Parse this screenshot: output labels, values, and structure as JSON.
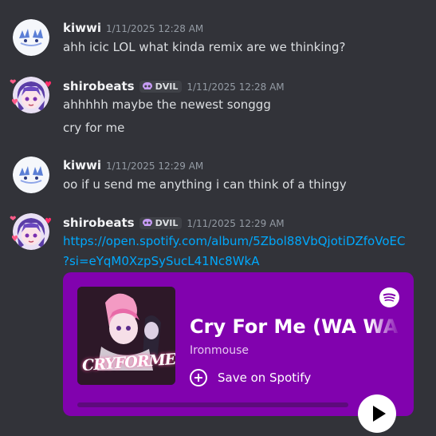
{
  "messages": [
    {
      "username": "kiwwi",
      "timestamp": "1/11/2025 12:28 AM",
      "lines": [
        "ahh icic LOL what kinda remix are we thinking?"
      ]
    },
    {
      "username": "shirobeats",
      "tag": "DVIL",
      "timestamp": "1/11/2025 12:28 AM",
      "lines": [
        "ahhhhh maybe the newest songgg",
        "cry for me"
      ]
    },
    {
      "username": "kiwwi",
      "timestamp": "1/11/2025 12:29 AM",
      "lines": [
        "oo if u send me anything i can think of a thingy"
      ]
    },
    {
      "username": "shirobeats",
      "tag": "DVIL",
      "timestamp": "1/11/2025 12:29 AM",
      "link_lines": [
        "https://open.spotify.com/album/5Zbol88VbQjotiDZfoVoEC",
        "?si=eYqM0XzpSySucL41Nc8WkA"
      ]
    }
  ],
  "embed": {
    "title": "Cry For Me (WA WA W",
    "artist": "Ironmouse",
    "save_label": "Save on Spotify",
    "cover_text": "CRYFORME",
    "accent": "#8102ae",
    "icons": {
      "brand": "spotify-icon",
      "save": "plus-circle-icon",
      "play": "play-icon"
    }
  },
  "colors": {
    "background": "#323339",
    "link": "#00a8fc",
    "text": "#dbdee1",
    "muted": "#949ba4"
  }
}
